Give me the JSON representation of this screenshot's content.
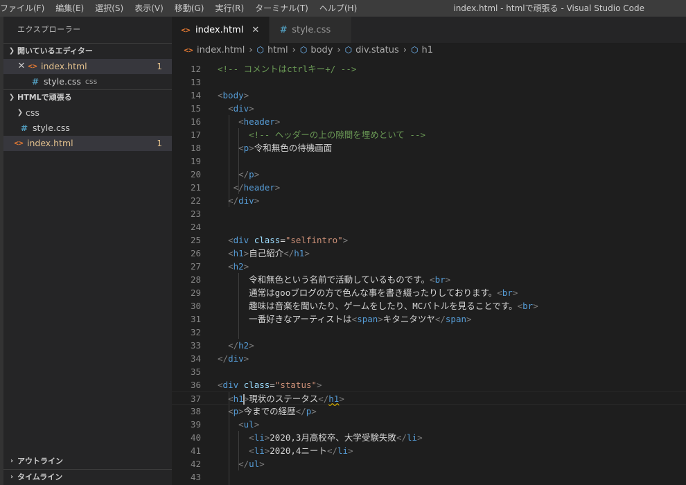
{
  "menu": [
    "ファイル(F)",
    "編集(E)",
    "選択(S)",
    "表示(V)",
    "移動(G)",
    "実行(R)",
    "ターミナル(T)",
    "ヘルプ(H)"
  ],
  "window_title": "index.html - htmlで頑張る - Visual Studio Code",
  "sidebar": {
    "title": "エクスプローラー",
    "open_editors": {
      "label": "開いているエディター",
      "items": [
        {
          "name": "index.html",
          "badge": "1"
        },
        {
          "name": "style.css",
          "desc": "css"
        }
      ]
    },
    "project": {
      "label": "HTMLで頑張る",
      "folder": "css",
      "items": [
        {
          "name": "style.css"
        },
        {
          "name": "index.html",
          "badge": "1"
        }
      ]
    },
    "outline_label": "アウトライン",
    "timeline_label": "タイムライン"
  },
  "tabs": [
    {
      "label": "index.html",
      "active": true
    },
    {
      "label": "style.css",
      "active": false
    }
  ],
  "breadcrumb": [
    "index.html",
    "html",
    "body",
    "div.status",
    "h1"
  ],
  "icons": {
    "html_file": "html-file-icon",
    "css_file": "css-hash-icon",
    "symbol": "cube-icon",
    "close": "close-icon",
    "chevron": "chevron-icon"
  },
  "colors": {
    "accent_html": "#e37933",
    "accent_css": "#519aba",
    "modified": "#e2c08d",
    "tag": "#569cd6",
    "attr": "#9cdcfe",
    "string": "#ce9178",
    "comment": "#6a9955"
  },
  "code_lines": [
    {
      "n": "12",
      "tokens": [
        [
          "com",
          "<!-- コメントはctrlキー+/ -->"
        ]
      ]
    },
    {
      "n": "13",
      "tokens": []
    },
    {
      "n": "14",
      "tokens": [
        [
          "br",
          "<"
        ],
        [
          "tag",
          "body"
        ],
        [
          "br",
          ">"
        ]
      ]
    },
    {
      "n": "15",
      "tokens": [
        [
          "txt",
          "  "
        ],
        [
          "br",
          "<"
        ],
        [
          "tag",
          "div"
        ],
        [
          "br",
          ">"
        ]
      ]
    },
    {
      "n": "16",
      "tokens": [
        [
          "txt",
          "    "
        ],
        [
          "br",
          "<"
        ],
        [
          "tag",
          "header"
        ],
        [
          "br",
          ">"
        ]
      ]
    },
    {
      "n": "17",
      "tokens": [
        [
          "txt",
          "      "
        ],
        [
          "com",
          "<!-- ヘッダーの上の隙間を埋めといて -->"
        ]
      ]
    },
    {
      "n": "18",
      "tokens": [
        [
          "txt",
          "    "
        ],
        [
          "br",
          "<"
        ],
        [
          "tag",
          "p"
        ],
        [
          "br",
          ">"
        ],
        [
          "txt",
          "令和無色の待機画面"
        ]
      ]
    },
    {
      "n": "19",
      "tokens": []
    },
    {
      "n": "20",
      "tokens": [
        [
          "txt",
          "    "
        ],
        [
          "br",
          "</"
        ],
        [
          "tag",
          "p"
        ],
        [
          "br",
          ">"
        ]
      ]
    },
    {
      "n": "21",
      "tokens": [
        [
          "txt",
          "   "
        ],
        [
          "br",
          "</"
        ],
        [
          "tag",
          "header"
        ],
        [
          "br",
          ">"
        ]
      ]
    },
    {
      "n": "22",
      "tokens": [
        [
          "txt",
          "  "
        ],
        [
          "br",
          "</"
        ],
        [
          "tag",
          "div"
        ],
        [
          "br",
          ">"
        ]
      ]
    },
    {
      "n": "23",
      "tokens": []
    },
    {
      "n": "24",
      "tokens": []
    },
    {
      "n": "25",
      "tokens": [
        [
          "txt",
          "  "
        ],
        [
          "br",
          "<"
        ],
        [
          "tag",
          "div"
        ],
        [
          "txt",
          " "
        ],
        [
          "attr",
          "class"
        ],
        [
          "txt",
          "="
        ],
        [
          "str",
          "\"selfintro\""
        ],
        [
          "br",
          ">"
        ]
      ]
    },
    {
      "n": "26",
      "tokens": [
        [
          "txt",
          "  "
        ],
        [
          "br",
          "<"
        ],
        [
          "tag",
          "h1"
        ],
        [
          "br",
          ">"
        ],
        [
          "txt",
          "自己紹介"
        ],
        [
          "br",
          "</"
        ],
        [
          "tag",
          "h1"
        ],
        [
          "br",
          ">"
        ]
      ]
    },
    {
      "n": "27",
      "tokens": [
        [
          "txt",
          "  "
        ],
        [
          "br",
          "<"
        ],
        [
          "tag",
          "h2"
        ],
        [
          "br",
          ">"
        ]
      ]
    },
    {
      "n": "28",
      "tokens": [
        [
          "txt",
          "      令和無色という名前で活動しているものです。"
        ],
        [
          "br",
          "<"
        ],
        [
          "tag",
          "br"
        ],
        [
          "br",
          ">"
        ]
      ]
    },
    {
      "n": "29",
      "tokens": [
        [
          "txt",
          "      通常はgooブログの方で色んな事を書き綴ったりしております。"
        ],
        [
          "br",
          "<"
        ],
        [
          "tag",
          "br"
        ],
        [
          "br",
          ">"
        ]
      ]
    },
    {
      "n": "30",
      "tokens": [
        [
          "txt",
          "      趣味は音楽を聞いたり、ゲームをしたり、MCバトルを見ることです。"
        ],
        [
          "br",
          "<"
        ],
        [
          "tag",
          "br"
        ],
        [
          "br",
          ">"
        ]
      ]
    },
    {
      "n": "31",
      "tokens": [
        [
          "txt",
          "      一番好きなアーティストは"
        ],
        [
          "br",
          "<"
        ],
        [
          "tag",
          "span"
        ],
        [
          "br",
          ">"
        ],
        [
          "txt",
          "キタニタツヤ"
        ],
        [
          "br",
          "</"
        ],
        [
          "tag",
          "span"
        ],
        [
          "br",
          ">"
        ]
      ]
    },
    {
      "n": "32",
      "tokens": []
    },
    {
      "n": "33",
      "tokens": [
        [
          "txt",
          "  "
        ],
        [
          "br",
          "</"
        ],
        [
          "tag",
          "h2"
        ],
        [
          "br",
          ">"
        ]
      ]
    },
    {
      "n": "34",
      "tokens": [
        [
          "br",
          "</"
        ],
        [
          "tag",
          "div"
        ],
        [
          "br",
          ">"
        ]
      ]
    },
    {
      "n": "35",
      "tokens": []
    },
    {
      "n": "36",
      "tokens": [
        [
          "br",
          "<"
        ],
        [
          "tag",
          "div"
        ],
        [
          "txt",
          " "
        ],
        [
          "attr",
          "class"
        ],
        [
          "txt",
          "="
        ],
        [
          "str",
          "\"status\""
        ],
        [
          "br",
          ">"
        ]
      ]
    },
    {
      "n": "37",
      "current": true,
      "tokens": [
        [
          "txt",
          "  "
        ],
        [
          "br",
          "<"
        ],
        [
          "tag",
          "h1"
        ],
        [
          "cursor",
          ""
        ],
        [
          "br",
          ">"
        ],
        [
          "txt",
          "現状のステータス"
        ],
        [
          "br",
          "</"
        ],
        [
          "warn",
          "h1"
        ],
        [
          "br",
          ">"
        ]
      ]
    },
    {
      "n": "38",
      "tokens": [
        [
          "txt",
          "  "
        ],
        [
          "br",
          "<"
        ],
        [
          "tag",
          "p"
        ],
        [
          "br",
          ">"
        ],
        [
          "txt",
          "今までの経歴"
        ],
        [
          "br",
          "</"
        ],
        [
          "tag",
          "p"
        ],
        [
          "br",
          ">"
        ]
      ]
    },
    {
      "n": "39",
      "tokens": [
        [
          "txt",
          "    "
        ],
        [
          "br",
          "<"
        ],
        [
          "tag",
          "ul"
        ],
        [
          "br",
          ">"
        ]
      ]
    },
    {
      "n": "40",
      "tokens": [
        [
          "txt",
          "      "
        ],
        [
          "br",
          "<"
        ],
        [
          "tag",
          "li"
        ],
        [
          "br",
          ">"
        ],
        [
          "txt",
          "2020,3月高校卒、大学受験失敗"
        ],
        [
          "br",
          "</"
        ],
        [
          "tag",
          "li"
        ],
        [
          "br",
          ">"
        ]
      ]
    },
    {
      "n": "41",
      "tokens": [
        [
          "txt",
          "      "
        ],
        [
          "br",
          "<"
        ],
        [
          "tag",
          "li"
        ],
        [
          "br",
          ">"
        ],
        [
          "txt",
          "2020,4ニート"
        ],
        [
          "br",
          "</"
        ],
        [
          "tag",
          "li"
        ],
        [
          "br",
          ">"
        ]
      ]
    },
    {
      "n": "42",
      "tokens": [
        [
          "txt",
          "    "
        ],
        [
          "br",
          "</"
        ],
        [
          "tag",
          "ul"
        ],
        [
          "br",
          ">"
        ]
      ]
    },
    {
      "n": "43",
      "tokens": []
    }
  ]
}
